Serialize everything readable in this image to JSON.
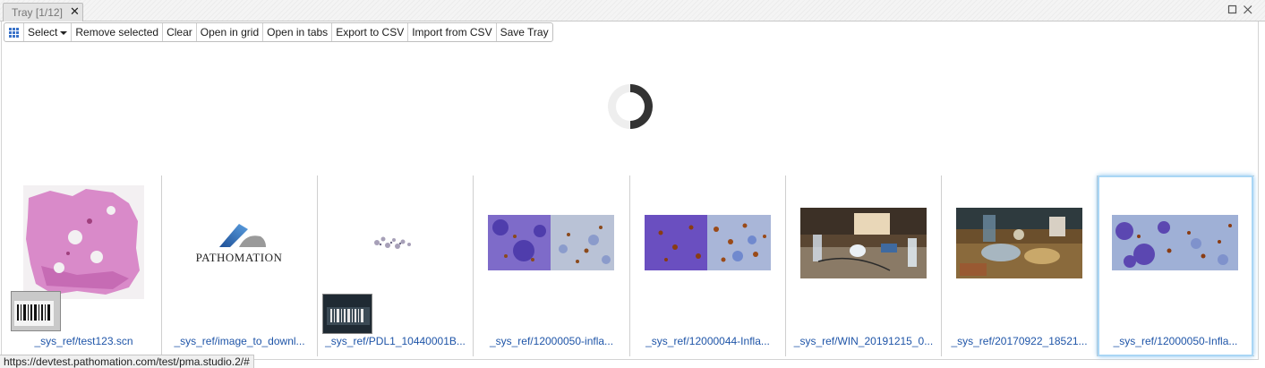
{
  "tab": {
    "title": "Tray [1/12]",
    "close_glyph": "✕"
  },
  "window_controls": [
    {
      "name": "maximize-icon"
    },
    {
      "name": "close-icon"
    }
  ],
  "toolbar": {
    "grid_icon": "grid-icon",
    "buttons": {
      "select": "Select",
      "remove_selected": "Remove selected",
      "clear": "Clear",
      "open_in_grid": "Open in grid",
      "open_in_tabs": "Open in tabs",
      "export_csv": "Export to CSV",
      "import_csv": "Import from CSV",
      "save_tray": "Save Tray"
    }
  },
  "slides": [
    {
      "label": "_sys_ref/test123.scn",
      "thumb": "he-tissue",
      "has_barcode_label": true,
      "selected": false
    },
    {
      "label": "_sys_ref/image_to_downl...",
      "thumb": "pathomation-logo",
      "logo_text": "PATHOMATION",
      "has_barcode_label": false,
      "selected": false
    },
    {
      "label": "_sys_ref/PDL1_10440001B...",
      "thumb": "small-tissue",
      "has_barcode_label": true,
      "selected": false
    },
    {
      "label": "_sys_ref/12000050-infla...",
      "thumb": "ihc-double",
      "has_barcode_label": false,
      "selected": false
    },
    {
      "label": "_sys_ref/12000044-Infla...",
      "thumb": "ihc-double-2",
      "has_barcode_label": false,
      "selected": false
    },
    {
      "label": "_sys_ref/WIN_20191215_0...",
      "thumb": "webcam-desk",
      "has_barcode_label": false,
      "selected": false
    },
    {
      "label": "_sys_ref/20170922_18521...",
      "thumb": "photo-table",
      "has_barcode_label": false,
      "selected": false
    },
    {
      "label": "_sys_ref/12000050-Infla...",
      "thumb": "ihc-single",
      "has_barcode_label": false,
      "selected": true
    }
  ],
  "status_url": "https://devtest.pathomation.com/test/pma.studio.2/#"
}
